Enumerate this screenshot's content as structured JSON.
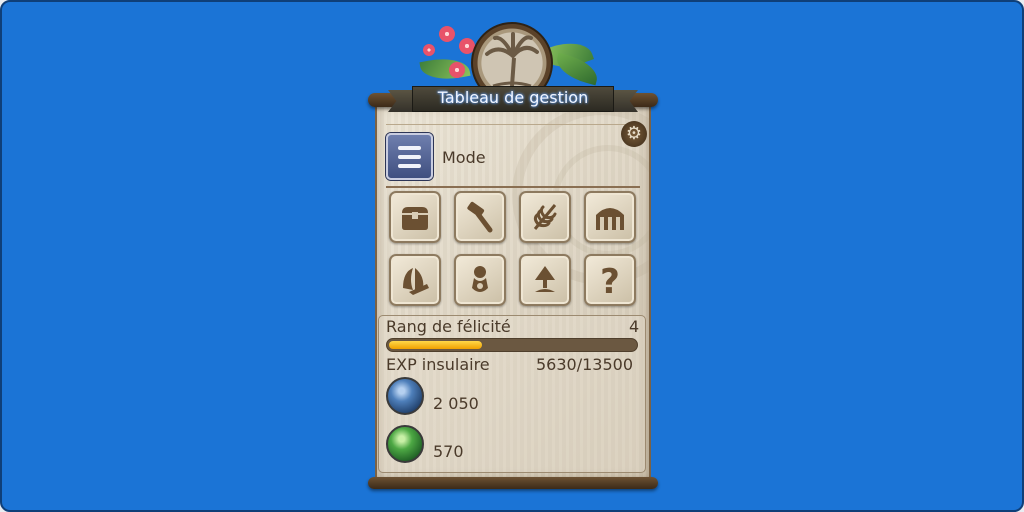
{
  "window": {
    "title": "Tableau de gestion",
    "background_color": "#1b74d6",
    "accent_color": "#f0a100"
  },
  "icons": {
    "emblem": "palm-tree-emblem-icon",
    "settings": "gear-icon",
    "mode": "hamburger-menu-icon"
  },
  "mode": {
    "label": "Mode"
  },
  "actions": [
    {
      "icon": "satchel-icon"
    },
    {
      "icon": "hammer-icon"
    },
    {
      "icon": "leaf-icon"
    },
    {
      "icon": "barn-icon"
    },
    {
      "icon": "sails-icon"
    },
    {
      "icon": "mammet-icon"
    },
    {
      "icon": "sapling-icon"
    },
    {
      "icon": "help-icon"
    }
  ],
  "stats": {
    "rank_label": "Rang de félicité",
    "rank_value": "4",
    "rank_progress": 0.38,
    "exp_label": "EXP insulaire",
    "exp_value": "5630/13500",
    "currencies": [
      {
        "icon": "seafarer-cowrie-icon",
        "color": "#4e7fba",
        "amount": "2 050"
      },
      {
        "icon": "islander-cowrie-icon",
        "color": "#4da844",
        "amount": "570"
      }
    ]
  }
}
